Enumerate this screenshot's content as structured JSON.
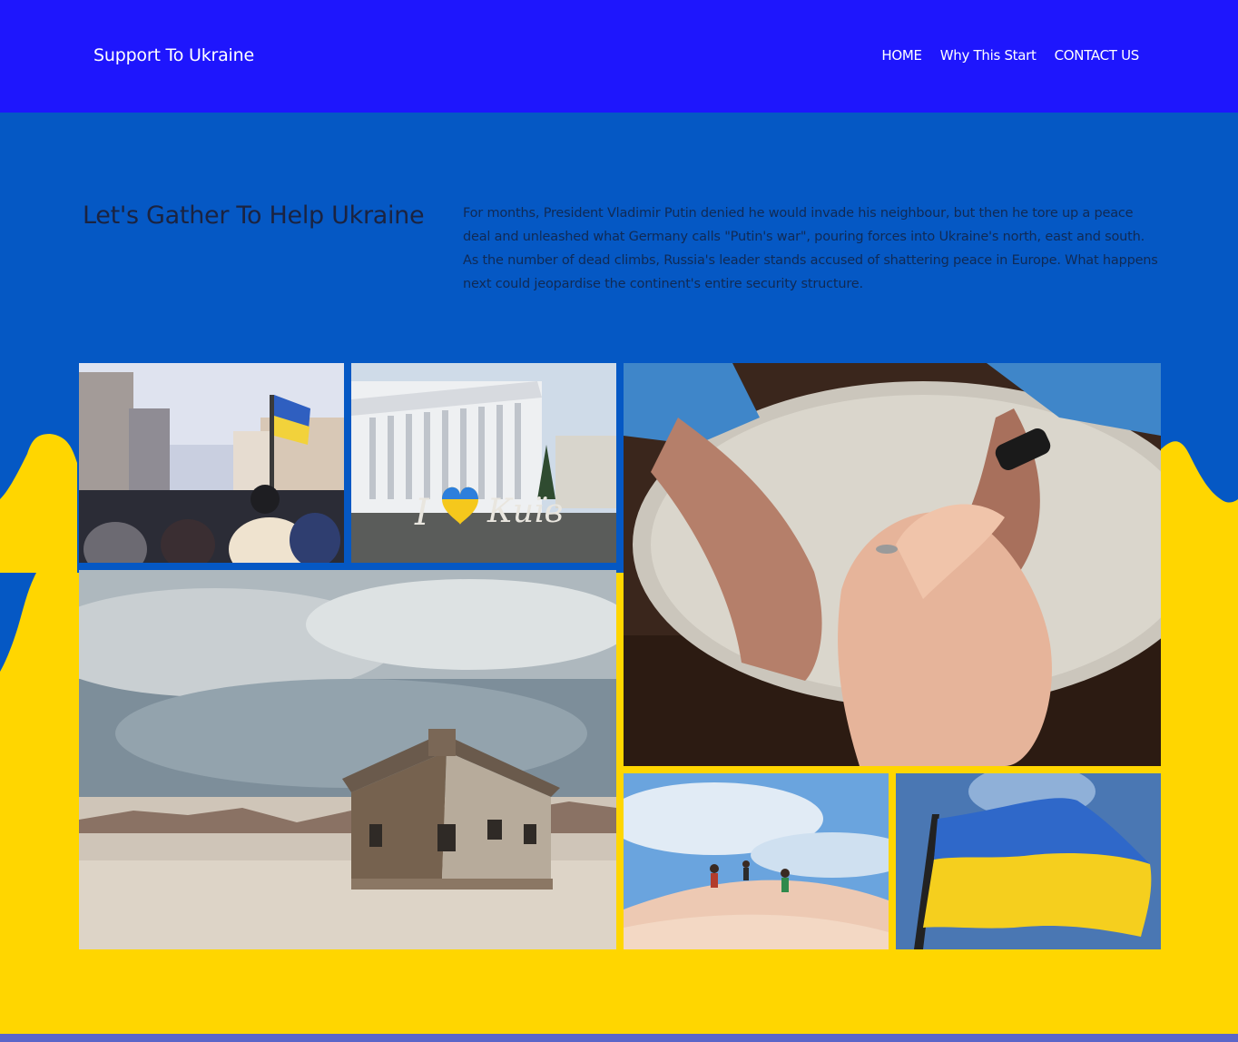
{
  "header": {
    "brand": "Support To Ukraine",
    "nav": [
      {
        "label": "HOME"
      },
      {
        "label": "Why This Start"
      },
      {
        "label": "CONTACT US"
      }
    ]
  },
  "hero": {
    "title": "Let's Gather To Help Ukraine",
    "text": "For months, President Vladimir Putin denied he would invade his neighbour, but then he tore up a peace deal and unleashed what Germany calls \"Putin's war\", pouring forces into Ukraine's north, east and south. As the number of dead climbs, Russia's leader stands accused of shattering peace in Europe. What happens next could jeopardise the continent's entire security structure."
  },
  "gallery": {
    "images": [
      {
        "name": "crowd-with-flag-image"
      },
      {
        "name": "kyiv-building-image"
      },
      {
        "name": "holding-hands-image"
      },
      {
        "name": "wooden-house-image"
      },
      {
        "name": "dune-runners-image"
      },
      {
        "name": "ukraine-flag-image"
      }
    ]
  },
  "colors": {
    "header": "#1e16fd",
    "hero": "#0558c4",
    "yellow": "#ffd600",
    "footer": "#5b66c9"
  }
}
